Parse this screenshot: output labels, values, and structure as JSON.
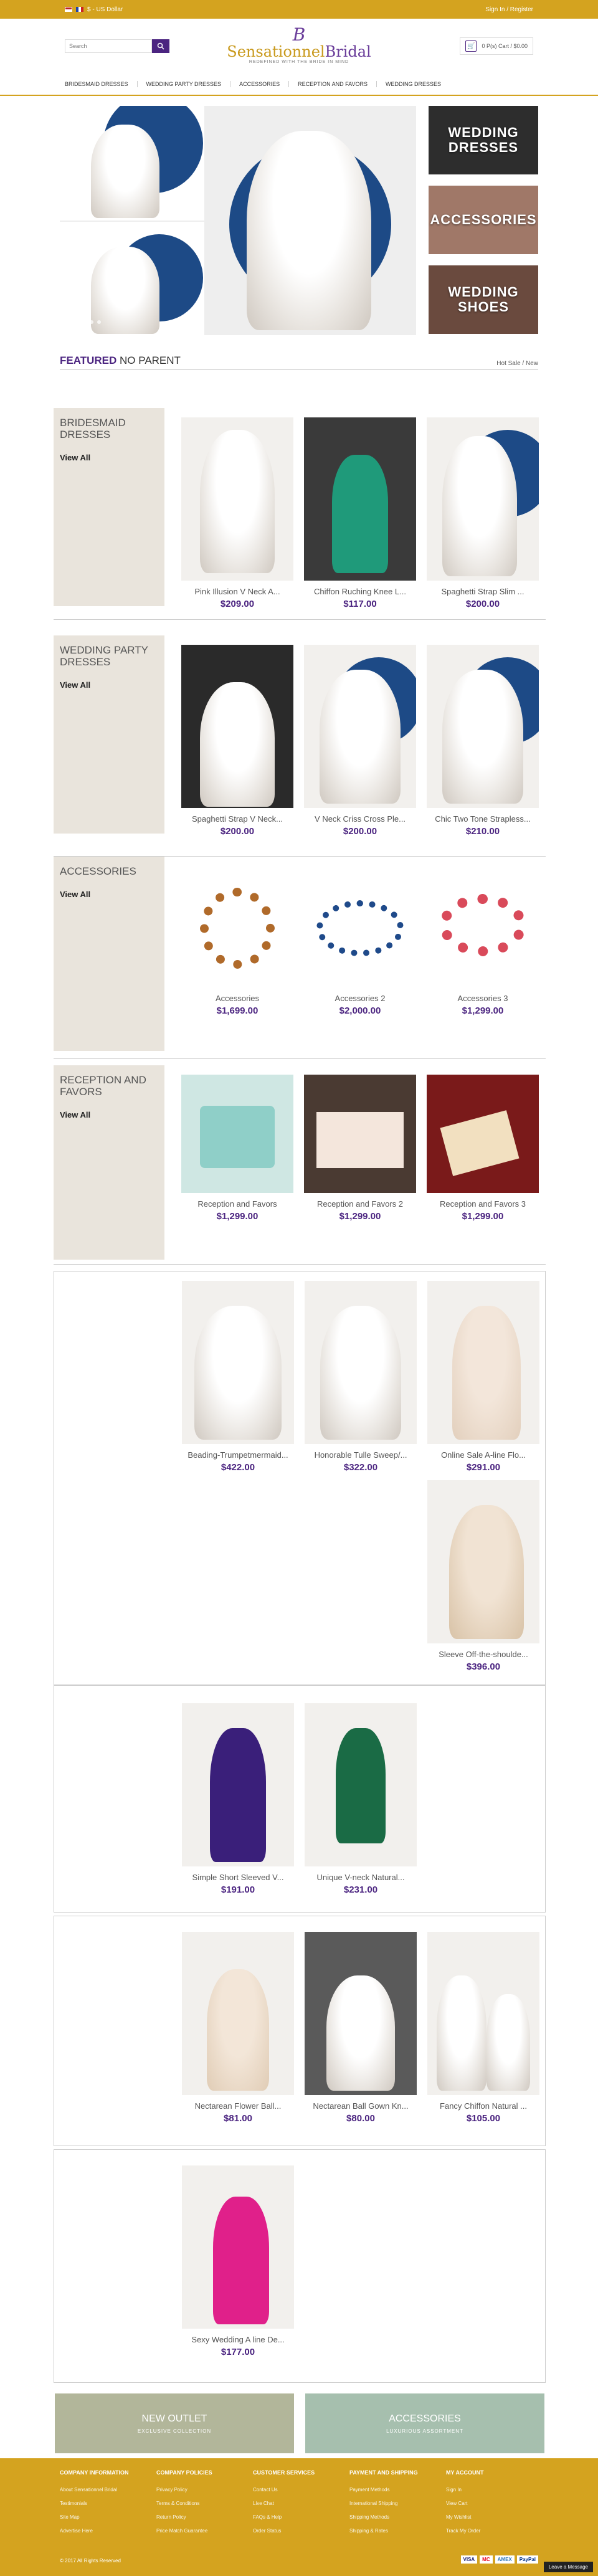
{
  "topbar": {
    "currency": "$ - US Dollar",
    "account": "Sign In / Register"
  },
  "header": {
    "search_placeholder": "Search",
    "logo_mono": "B",
    "logo_name_a": "Sensationnel",
    "logo_name_b": "Bridal",
    "logo_tag": "REDEFINED WITH THE BRIDE IN MIND",
    "cart": "0 P(s) Cart / $0.00"
  },
  "nav": [
    "BRIDESMAID DRESSES",
    "WEDDING PARTY DRESSES",
    "ACCESSORIES",
    "RECEPTION AND FAVORS",
    "WEDDING DRESSES"
  ],
  "promos": [
    "WEDDING DRESSES",
    "ACCESSORIES",
    "WEDDING SHOES"
  ],
  "featured": {
    "title_bold": "FEATURED",
    "title_rest": " NO PARENT",
    "tabs": "Hot Sale / New"
  },
  "sections": [
    {
      "category": "BRIDESMAID DRESSES",
      "view": "View All",
      "items": [
        {
          "name": "Pink Illusion V Neck A...",
          "price": "$209.00"
        },
        {
          "name": "Chiffon Ruching Knee L...",
          "price": "$117.00"
        },
        {
          "name": "Spaghetti Strap Slim ...",
          "price": "$200.00"
        }
      ]
    },
    {
      "category": "WEDDING PARTY DRESSES",
      "view": "View All",
      "items": [
        {
          "name": "Spaghetti Strap V Neck...",
          "price": "$200.00"
        },
        {
          "name": "V Neck Criss Cross Ple...",
          "price": "$200.00"
        },
        {
          "name": "Chic Two Tone Strapless...",
          "price": "$210.00"
        }
      ]
    },
    {
      "category": "ACCESSORIES",
      "view": "View All",
      "items": [
        {
          "name": "Accessories",
          "price": "$1,699.00"
        },
        {
          "name": "Accessories 2",
          "price": "$2,000.00"
        },
        {
          "name": "Accessories 3",
          "price": "$1,299.00"
        }
      ]
    },
    {
      "category": "RECEPTION AND FAVORS",
      "view": "View All",
      "items": [
        {
          "name": "Reception and Favors",
          "price": "$1,299.00"
        },
        {
          "name": "Reception and Favors 2",
          "price": "$1,299.00"
        },
        {
          "name": "Reception and Favors 3",
          "price": "$1,299.00"
        }
      ]
    }
  ],
  "groups": [
    {
      "items": [
        {
          "name": "Beading-Trumpetmermaid...",
          "price": "$422.00"
        },
        {
          "name": "Honorable Tulle Sweep/...",
          "price": "$322.00"
        },
        {
          "name": "Online Sale A-line Flo...",
          "price": "$291.00"
        },
        {
          "name": "Sleeve Off-the-shoulde...",
          "price": "$396.00"
        }
      ]
    },
    {
      "items": [
        {
          "name": "Simple Short Sleeved V...",
          "price": "$191.00"
        },
        {
          "name": "Unique V-neck Natural...",
          "price": "$231.00"
        }
      ]
    },
    {
      "items": [
        {
          "name": "Nectarean Flower Ball...",
          "price": "$81.00"
        },
        {
          "name": "Nectarean Ball Gown Kn...",
          "price": "$80.00"
        },
        {
          "name": "Fancy Chiffon Natural ...",
          "price": "$105.00"
        }
      ]
    },
    {
      "items": [
        {
          "name": "Sexy Wedding A line De...",
          "price": "$177.00"
        }
      ]
    }
  ],
  "banners": [
    {
      "title": "NEW OUTLET",
      "sub": "EXCLUSIVE COLLECTION"
    },
    {
      "title": "ACCESSORIES",
      "sub": "LUXURIOUS ASSORTMENT"
    }
  ],
  "footer": {
    "columns": [
      {
        "title": "COMPANY INFORMATION",
        "links": [
          "About Sensationnel Bridal",
          "Testimonials",
          "Site Map",
          "Advertise Here"
        ]
      },
      {
        "title": "COMPANY POLICIES",
        "links": [
          "Privacy Policy",
          "Terms & Conditions",
          "Return Policy",
          "Price Match Guarantee"
        ]
      },
      {
        "title": "CUSTOMER SERVICES",
        "links": [
          "Contact Us",
          "Live Chat",
          "FAQs & Help",
          "Order Status"
        ]
      },
      {
        "title": "PAYMENT AND SHIPPING",
        "links": [
          "Payment Methods",
          "International Shipping",
          "Shipping Methods",
          "Shipping & Rates"
        ]
      },
      {
        "title": "MY ACCOUNT",
        "links": [
          "Sign In",
          "View Cart",
          "My Wishlist",
          "Track My Order"
        ]
      }
    ],
    "copyright": "© 2017 All Rights Reserved",
    "payments": [
      "VISA",
      "MC",
      "AMEX",
      "PayPal"
    ]
  },
  "chat": "Leave a Message",
  "colors": {
    "gold": "#d4a31f",
    "purple": "#4b2480"
  }
}
